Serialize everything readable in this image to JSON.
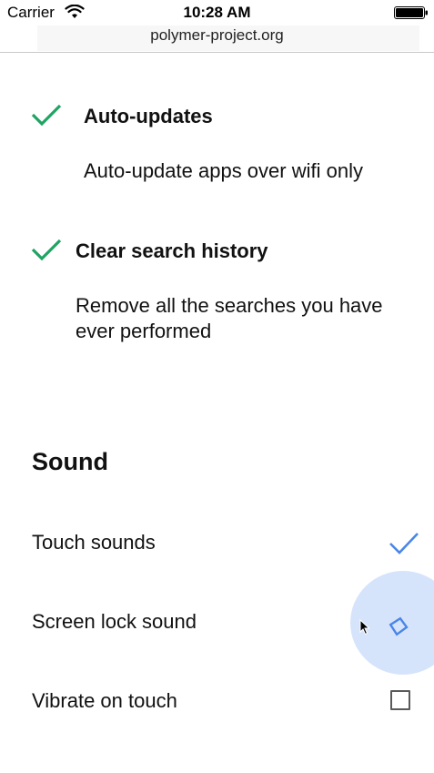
{
  "status_bar": {
    "carrier": "Carrier",
    "time": "10:28 AM"
  },
  "browser": {
    "url": "polymer-project.org"
  },
  "settings": {
    "auto_updates": {
      "title": "Auto-updates",
      "description": "Auto-update apps over wifi only",
      "checked": true
    },
    "clear_history": {
      "title": "Clear search history",
      "description_line1": "Remove all the searches you have",
      "description_line2": "ever performed",
      "checked": true
    }
  },
  "sound": {
    "title": "Sound",
    "items": [
      {
        "label": "Touch sounds",
        "state": "checked"
      },
      {
        "label": "Screen lock sound",
        "state": "toggling"
      },
      {
        "label": "Vibrate on touch",
        "state": "unchecked"
      }
    ]
  },
  "colors": {
    "green_check": "#1fa463",
    "blue_accent": "#4a86e8",
    "ripple": "#d6e4fb"
  },
  "icons": [
    "wifi-icon",
    "battery-icon",
    "checkmark-icon",
    "diamond-icon",
    "cursor-icon",
    "checkbox"
  ]
}
